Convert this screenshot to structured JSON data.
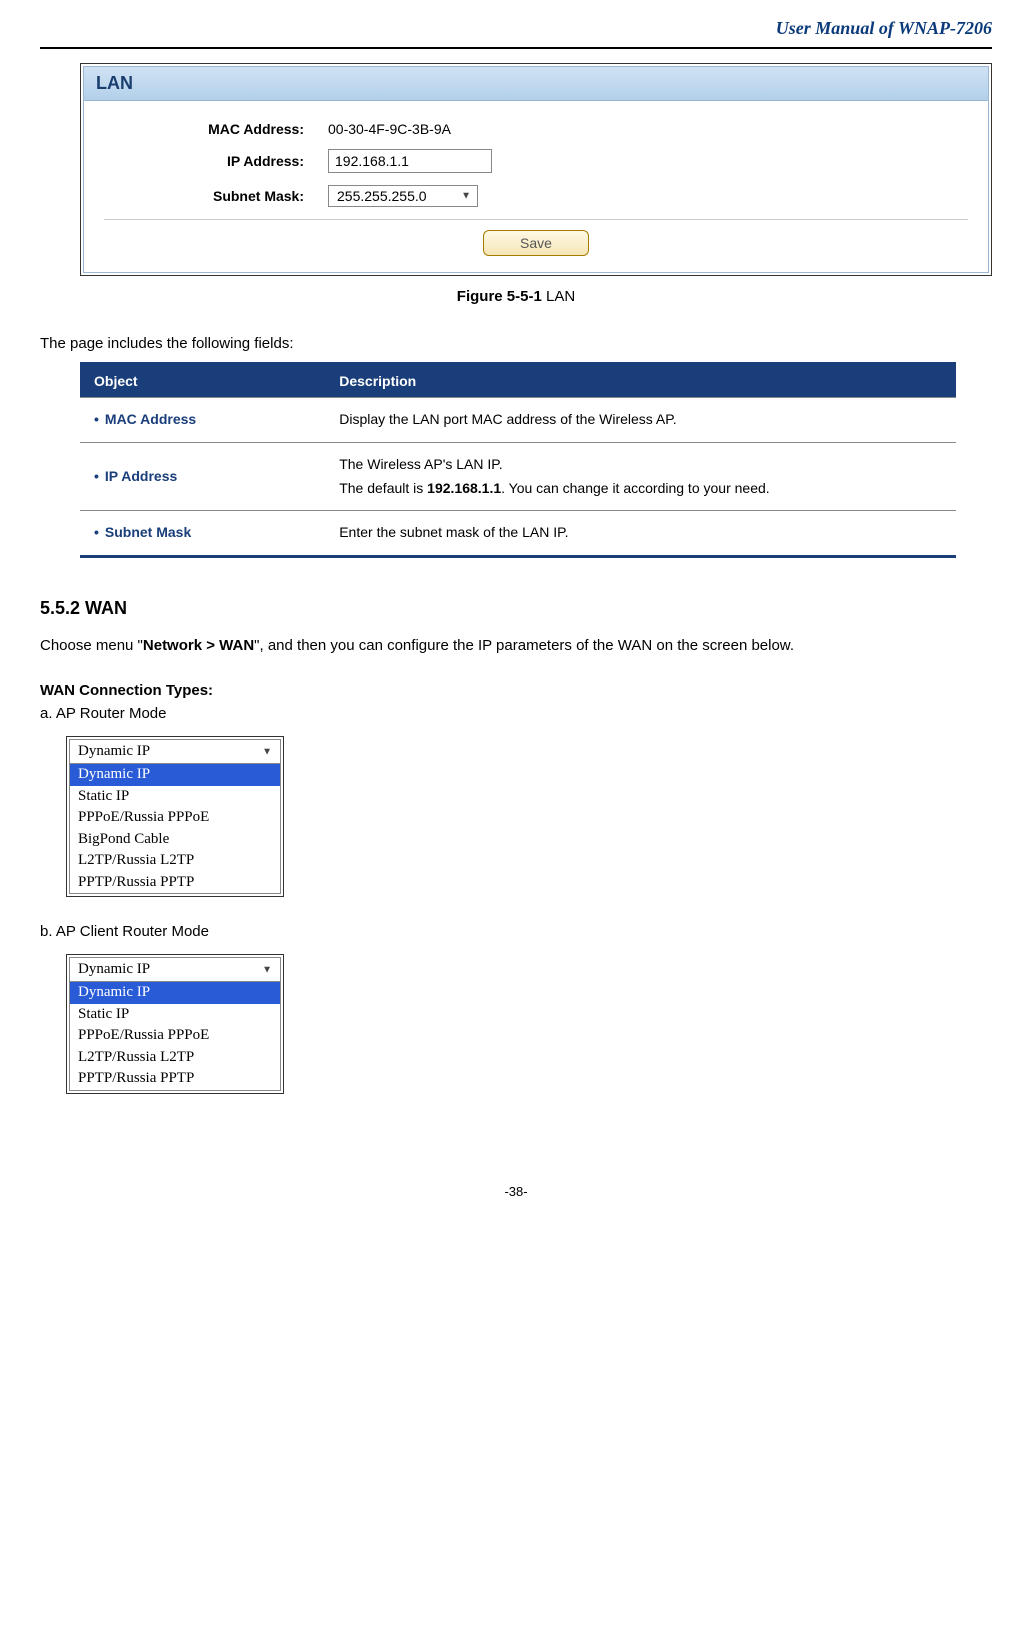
{
  "header_title": "User Manual of WNAP-7206",
  "lan_panel": {
    "title": "LAN",
    "mac_label": "MAC Address:",
    "mac_value": "00-30-4F-9C-3B-9A",
    "ip_label": "IP Address:",
    "ip_value": "192.168.1.1",
    "subnet_label": "Subnet Mask:",
    "subnet_value": "255.255.255.0",
    "save_label": "Save"
  },
  "figure_caption_bold": "Figure 5-5-1",
  "figure_caption_text": " LAN",
  "intro_text": "The page includes the following fields:",
  "obj_table": {
    "hdr_object": "Object",
    "hdr_description": "Description",
    "rows": [
      {
        "name": "MAC Address",
        "desc_html": "Display the LAN port MAC address of the Wireless AP."
      },
      {
        "name": "IP Address",
        "desc_html": "The Wireless AP's LAN IP.<br>The default is <b>192.168.1.1</b>. You can change it according to your need."
      },
      {
        "name": "Subnet Mask",
        "desc_html": "Enter the subnet mask of the LAN IP."
      }
    ]
  },
  "section552_title": "5.5.2   WAN",
  "section552_para_pre": "Choose menu \"",
  "section552_para_bold": "Network > WAN",
  "section552_para_post": "\", and then you can configure the IP parameters of the WAN on the screen below.",
  "wan_types_heading": "WAN Connection Types:",
  "item_a": "a.    AP Router Mode",
  "item_b": "b.    AP Client Router Mode",
  "dropdown_a": {
    "selected": "Dynamic IP",
    "options": [
      "Dynamic IP",
      "Static IP",
      "PPPoE/Russia PPPoE",
      "BigPond Cable",
      "L2TP/Russia L2TP",
      "PPTP/Russia PPTP"
    ]
  },
  "dropdown_b": {
    "selected": "Dynamic IP",
    "options": [
      "Dynamic IP",
      "Static IP",
      "PPPoE/Russia PPPoE",
      "L2TP/Russia L2TP",
      "PPTP/Russia PPTP"
    ]
  },
  "page_number": "-38-"
}
